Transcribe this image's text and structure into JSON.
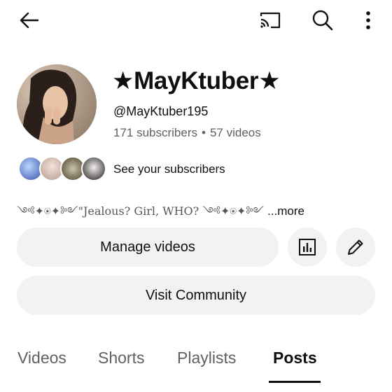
{
  "topbar": {
    "back_icon": "arrow-left-icon",
    "cast_icon": "cast-icon",
    "search_icon": "search-icon",
    "more_icon": "more-vert-icon"
  },
  "channel": {
    "name": "★MayKtuber★",
    "handle": "@MayKtuber195",
    "subscribers": "171 subscribers",
    "separator": "•",
    "videos": "57 videos"
  },
  "subscribers_preview": {
    "label": "See your subscribers"
  },
  "description": {
    "text": "༺✦⍟✦༻\"Jealous? Girl, WHO? ༺✦⍟✦༻ ",
    "more_label": "...more"
  },
  "actions": {
    "manage_label": "Manage videos",
    "analytics_icon": "analytics-icon",
    "edit_icon": "pencil-icon",
    "community_label": "Visit Community"
  },
  "tabs": [
    {
      "label": "Videos",
      "active": false
    },
    {
      "label": "Shorts",
      "active": false
    },
    {
      "label": "Playlists",
      "active": false
    },
    {
      "label": "Posts",
      "active": true
    }
  ]
}
